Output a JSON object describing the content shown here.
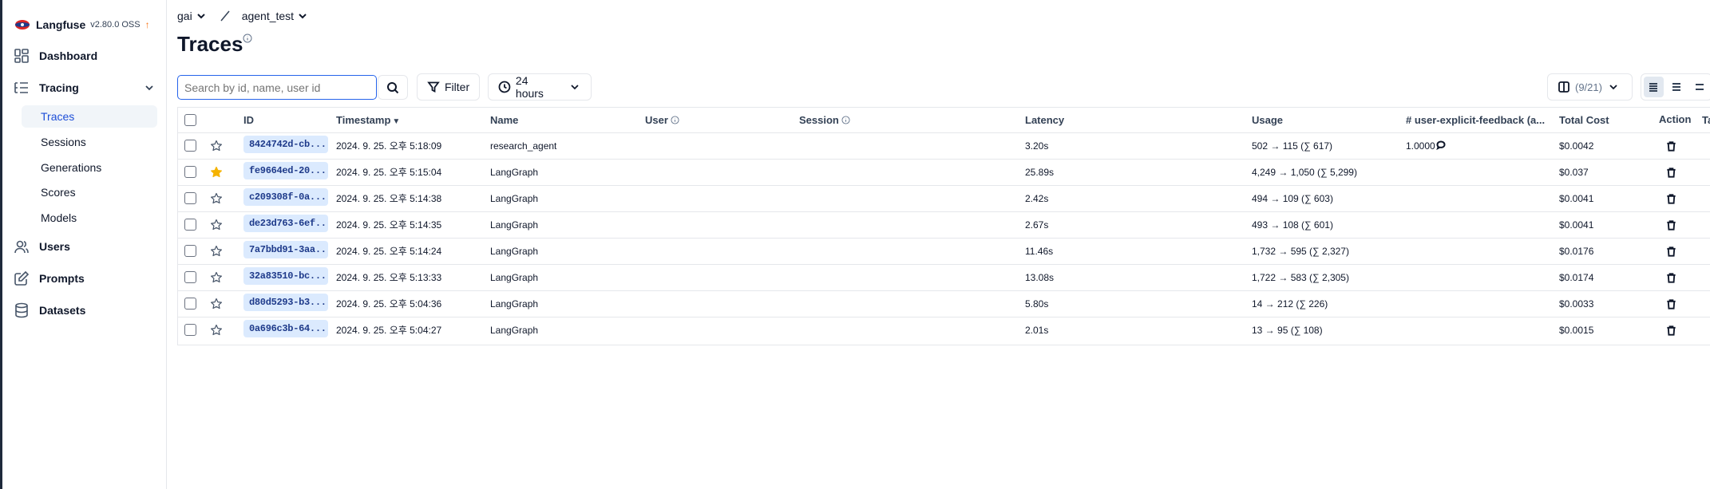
{
  "sidebar": {
    "brand": {
      "name": "Langfuse",
      "version": "v2.80.0 OSS",
      "update_icon": "arrow-up-icon"
    },
    "items": [
      {
        "label": "Dashboard",
        "icon": "dashboard-grid-icon"
      },
      {
        "label": "Tracing",
        "icon": "tracing-list-icon",
        "expanded": true
      },
      {
        "label": "Users",
        "icon": "users-icon"
      },
      {
        "label": "Prompts",
        "icon": "prompts-edit-icon"
      },
      {
        "label": "Datasets",
        "icon": "database-icon"
      }
    ],
    "tracing_subitems": [
      {
        "label": "Traces",
        "active": true
      },
      {
        "label": "Sessions"
      },
      {
        "label": "Generations"
      },
      {
        "label": "Scores"
      },
      {
        "label": "Models"
      }
    ]
  },
  "breadcrumb": {
    "project": "gai",
    "separator": "/",
    "environment": "agent_test"
  },
  "page": {
    "title": "Traces"
  },
  "toolbar": {
    "search_placeholder": "Search by id, name, user id",
    "filter_label": "Filter",
    "time_range_label": "24 hours",
    "columns_label": "(9/21)"
  },
  "table": {
    "columns": [
      "ID",
      "Timestamp",
      "Name",
      "User",
      "Session",
      "Latency",
      "Usage",
      "# user-explicit-feedback (a...",
      "Total Cost",
      "Tags",
      "Action"
    ],
    "rows": [
      {
        "id": "8424742d-cb...",
        "starred": false,
        "timestamp": "2024. 9. 25. 오후 5:18:09",
        "name": "research_agent",
        "user": "",
        "session": "",
        "latency": "3.20s",
        "usage": "502 → 115 (∑ 617)",
        "feedback": "1.0000",
        "has_comment": true,
        "cost": "$0.0042",
        "tags": ""
      },
      {
        "id": "fe9664ed-20...",
        "starred": true,
        "timestamp": "2024. 9. 25. 오후 5:15:04",
        "name": "LangGraph",
        "user": "",
        "session": "",
        "latency": "25.89s",
        "usage": "4,249 → 1,050 (∑ 5,299)",
        "feedback": "",
        "has_comment": false,
        "cost": "$0.037",
        "tags": ""
      },
      {
        "id": "c209308f-0a...",
        "starred": false,
        "timestamp": "2024. 9. 25. 오후 5:14:38",
        "name": "LangGraph",
        "user": "",
        "session": "",
        "latency": "2.42s",
        "usage": "494 → 109 (∑ 603)",
        "feedback": "",
        "has_comment": false,
        "cost": "$0.0041",
        "tags": ""
      },
      {
        "id": "de23d763-6ef...",
        "starred": false,
        "timestamp": "2024. 9. 25. 오후 5:14:35",
        "name": "LangGraph",
        "user": "",
        "session": "",
        "latency": "2.67s",
        "usage": "493 → 108 (∑ 601)",
        "feedback": "",
        "has_comment": false,
        "cost": "$0.0041",
        "tags": ""
      },
      {
        "id": "7a7bbd91-3aa...",
        "starred": false,
        "timestamp": "2024. 9. 25. 오후 5:14:24",
        "name": "LangGraph",
        "user": "",
        "session": "",
        "latency": "11.46s",
        "usage": "1,732 → 595 (∑ 2,327)",
        "feedback": "",
        "has_comment": false,
        "cost": "$0.0176",
        "tags": ""
      },
      {
        "id": "32a83510-bc...",
        "starred": false,
        "timestamp": "2024. 9. 25. 오후 5:13:33",
        "name": "LangGraph",
        "user": "",
        "session": "",
        "latency": "13.08s",
        "usage": "1,722 → 583 (∑ 2,305)",
        "feedback": "",
        "has_comment": false,
        "cost": "$0.0174",
        "tags": ""
      },
      {
        "id": "d80d5293-b3...",
        "starred": false,
        "timestamp": "2024. 9. 25. 오후 5:04:36",
        "name": "LangGraph",
        "user": "",
        "session": "",
        "latency": "5.80s",
        "usage": "14 → 212 (∑ 226)",
        "feedback": "",
        "has_comment": false,
        "cost": "$0.0033",
        "tags": ""
      },
      {
        "id": "0a696c3b-64...",
        "starred": false,
        "timestamp": "2024. 9. 25. 오후 5:04:27",
        "name": "LangGraph",
        "user": "",
        "session": "",
        "latency": "2.01s",
        "usage": "13 → 95 (∑ 108)",
        "feedback": "",
        "has_comment": false,
        "cost": "$0.0015",
        "tags": ""
      }
    ]
  },
  "colors": {
    "accent": "#2563eb",
    "id_badge_bg": "#dbeafe",
    "star_filled": "#f5b301",
    "update_arrow": "#f97316"
  }
}
